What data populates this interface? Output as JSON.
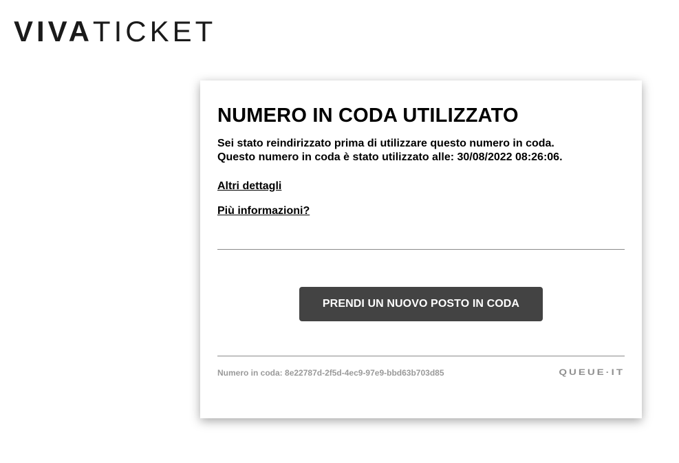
{
  "brand": {
    "logo_bold": "VIVA",
    "logo_light": "TICKET"
  },
  "card": {
    "title": "NUMERO IN CODA UTILIZZATO",
    "message_line1": "Sei stato reindirizzato prima di utilizzare questo numero in coda.",
    "message_line2": "Questo numero in coda è stato utilizzato alle: 30/08/2022 08:26:06.",
    "link_details": "Altri dettagli",
    "link_more_info": "Più informazioni?",
    "button_label": "PRENDI UN NUOVO POSTO IN CODA",
    "queue_number_label": "Numero in coda:",
    "queue_number_value": "8e22787d-2f5d-4ec9-97e9-bbd63b703d85",
    "footer_logo": "QUEUE·IT"
  },
  "colors": {
    "button_bg": "#434343",
    "footer_text": "#9a9a9a"
  }
}
